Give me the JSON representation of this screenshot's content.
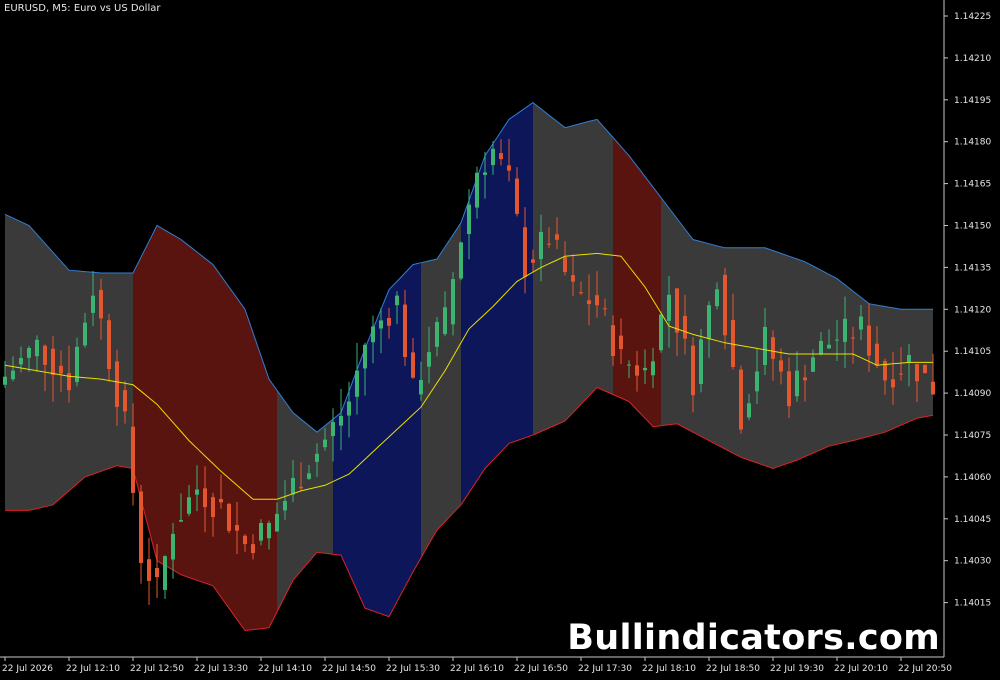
{
  "chart_title": "EURUSD, M5:  Euro vs US Dollar",
  "watermark": "Bullindicators.com",
  "colors": {
    "background": "#000000",
    "axis": "#c8c8c8",
    "bull_candle": "#3cb371",
    "bear_candle": "#e4572e",
    "strong_bear_candle": "#ff2a00",
    "strong_bull_candle": "#2fe06a",
    "band_upper": "#2f7fd6",
    "band_lower": "#e0202a",
    "middle_line": "#e8e000",
    "zone_neutral": "#3a3a3a",
    "zone_bear": "#5a1410",
    "zone_bull": "#0c1658"
  },
  "chart_data": {
    "type": "candlestick",
    "symbol": "EURUSD",
    "timeframe": "M5",
    "title": "EURUSD, M5:  Euro vs US Dollar",
    "y_ticks": [
      "1.14225",
      "1.14210",
      "1.14195",
      "1.14180",
      "1.14165",
      "1.14150",
      "1.14135",
      "1.14120",
      "1.14105",
      "1.14090",
      "1.14075",
      "1.14060",
      "1.14045",
      "1.14030",
      "1.14015"
    ],
    "y_tick_values": [
      1.14225,
      1.1421,
      1.14195,
      1.1418,
      1.14165,
      1.1415,
      1.14135,
      1.1412,
      1.14105,
      1.1409,
      1.14075,
      1.1406,
      1.14045,
      1.1403,
      1.14015
    ],
    "x_ticks": [
      "22 Jul 2026",
      "22 Jul 12:10",
      "22 Jul 12:50",
      "22 Jul 13:30",
      "22 Jul 14:10",
      "22 Jul 14:50",
      "22 Jul 15:30",
      "22 Jul 16:10",
      "22 Jul 16:50",
      "22 Jul 17:30",
      "22 Jul 18:10",
      "22 Jul 18:50",
      "22 Jul 19:30",
      "22 Jul 20:10",
      "22 Jul 20:50"
    ],
    "x_tick_bars": [
      0,
      8,
      16,
      24,
      32,
      40,
      48,
      56,
      64,
      72,
      80,
      88,
      96,
      104,
      112
    ],
    "bar_count": 117,
    "upper_band_keypoints": [
      [
        0,
        1.14154
      ],
      [
        3,
        1.1415
      ],
      [
        8,
        1.14134
      ],
      [
        12,
        1.14133
      ],
      [
        16,
        1.14133
      ],
      [
        19,
        1.1415
      ],
      [
        22,
        1.14145
      ],
      [
        26,
        1.14136
      ],
      [
        30,
        1.1412
      ],
      [
        33,
        1.14095
      ],
      [
        36,
        1.14083
      ],
      [
        39,
        1.14076
      ],
      [
        42,
        1.14083
      ],
      [
        45,
        1.14106
      ],
      [
        48,
        1.14127
      ],
      [
        51,
        1.14136
      ],
      [
        54,
        1.14138
      ],
      [
        57,
        1.14151
      ],
      [
        60,
        1.14175
      ],
      [
        63,
        1.14188
      ],
      [
        66,
        1.14194
      ],
      [
        70,
        1.14185
      ],
      [
        74,
        1.14188
      ],
      [
        78,
        1.14175
      ],
      [
        82,
        1.1416
      ],
      [
        86,
        1.14145
      ],
      [
        90,
        1.14142
      ],
      [
        95,
        1.14142
      ],
      [
        100,
        1.14137
      ],
      [
        104,
        1.14131
      ],
      [
        108,
        1.14122
      ],
      [
        112,
        1.1412
      ],
      [
        116,
        1.1412
      ]
    ],
    "lower_band_keypoints": [
      [
        0,
        1.14048
      ],
      [
        3,
        1.14048
      ],
      [
        6,
        1.1405
      ],
      [
        10,
        1.1406
      ],
      [
        14,
        1.14064
      ],
      [
        16,
        1.14063
      ],
      [
        19,
        1.1403
      ],
      [
        22,
        1.14025
      ],
      [
        26,
        1.14021
      ],
      [
        30,
        1.14005
      ],
      [
        33,
        1.14006
      ],
      [
        36,
        1.14023
      ],
      [
        39,
        1.14033
      ],
      [
        42,
        1.14032
      ],
      [
        45,
        1.14013
      ],
      [
        48,
        1.1401
      ],
      [
        51,
        1.14026
      ],
      [
        54,
        1.14041
      ],
      [
        57,
        1.1405
      ],
      [
        60,
        1.14063
      ],
      [
        63,
        1.14072
      ],
      [
        66,
        1.14075
      ],
      [
        70,
        1.1408
      ],
      [
        74,
        1.14092
      ],
      [
        78,
        1.14087
      ],
      [
        81,
        1.14078
      ],
      [
        84,
        1.14079
      ],
      [
        88,
        1.14073
      ],
      [
        92,
        1.14067
      ],
      [
        96,
        1.14063
      ],
      [
        99,
        1.14066
      ],
      [
        103,
        1.14071
      ],
      [
        106,
        1.14073
      ],
      [
        110,
        1.14076
      ],
      [
        114,
        1.14081
      ],
      [
        116,
        1.14082
      ]
    ],
    "middle_line_keypoints": [
      [
        0,
        1.141
      ],
      [
        4,
        1.14098
      ],
      [
        8,
        1.14096
      ],
      [
        12,
        1.14095
      ],
      [
        16,
        1.14093
      ],
      [
        19,
        1.14086
      ],
      [
        23,
        1.14073
      ],
      [
        27,
        1.14062
      ],
      [
        31,
        1.14052
      ],
      [
        34,
        1.14052
      ],
      [
        37,
        1.14055
      ],
      [
        40,
        1.14057
      ],
      [
        43,
        1.14061
      ],
      [
        46,
        1.14069
      ],
      [
        49,
        1.14077
      ],
      [
        52,
        1.14085
      ],
      [
        55,
        1.14098
      ],
      [
        58,
        1.14113
      ],
      [
        61,
        1.14121
      ],
      [
        64,
        1.1413
      ],
      [
        67,
        1.14135
      ],
      [
        70,
        1.14139
      ],
      [
        74,
        1.1414
      ],
      [
        77,
        1.14139
      ],
      [
        80,
        1.14128
      ],
      [
        83,
        1.14114
      ],
      [
        86,
        1.14111
      ],
      [
        90,
        1.14108
      ],
      [
        94,
        1.14106
      ],
      [
        98,
        1.14104
      ],
      [
        102,
        1.14104
      ],
      [
        106,
        1.14104
      ],
      [
        109,
        1.141
      ],
      [
        113,
        1.14101
      ],
      [
        116,
        1.14101
      ]
    ],
    "zones": [
      {
        "type": "neutral",
        "start": 0,
        "end": 15
      },
      {
        "type": "bear",
        "start": 16,
        "end": 33
      },
      {
        "type": "neutral",
        "start": 34,
        "end": 40
      },
      {
        "type": "bull",
        "start": 41,
        "end": 51
      },
      {
        "type": "neutral",
        "start": 52,
        "end": 56
      },
      {
        "type": "bull",
        "start": 57,
        "end": 65
      },
      {
        "type": "neutral",
        "start": 66,
        "end": 75
      },
      {
        "type": "bear",
        "start": 76,
        "end": 81
      },
      {
        "type": "neutral",
        "start": 82,
        "end": 116
      }
    ],
    "ohlc_anchor_closes": [
      [
        0,
        1.14096
      ],
      [
        4,
        1.14107
      ],
      [
        8,
        1.14095
      ],
      [
        11,
        1.14128
      ],
      [
        15,
        1.14078
      ],
      [
        17,
        1.14032
      ],
      [
        19,
        1.14019
      ],
      [
        21,
        1.14043
      ],
      [
        24,
        1.14056
      ],
      [
        27,
        1.14049
      ],
      [
        30,
        1.14036
      ],
      [
        33,
        1.14042
      ],
      [
        36,
        1.14057
      ],
      [
        40,
        1.14073
      ],
      [
        43,
        1.14087
      ],
      [
        45,
        1.14108
      ],
      [
        47,
        1.14116
      ],
      [
        49,
        1.14123
      ],
      [
        51,
        1.1409
      ],
      [
        53,
        1.14107
      ],
      [
        55,
        1.14116
      ],
      [
        57,
        1.14146
      ],
      [
        59,
        1.1417
      ],
      [
        61,
        1.14177
      ],
      [
        63,
        1.14165
      ],
      [
        65,
        1.14136
      ],
      [
        68,
        1.14146
      ],
      [
        71,
        1.14126
      ],
      [
        74,
        1.14122
      ],
      [
        77,
        1.14102
      ],
      [
        80,
        1.14098
      ],
      [
        83,
        1.14126
      ],
      [
        86,
        1.14095
      ],
      [
        89,
        1.14133
      ],
      [
        92,
        1.14082
      ],
      [
        95,
        1.14109
      ],
      [
        98,
        1.1409
      ],
      [
        101,
        1.14104
      ],
      [
        104,
        1.1411
      ],
      [
        107,
        1.14113
      ],
      [
        110,
        1.14096
      ],
      [
        113,
        1.14102
      ],
      [
        116,
        1.14092
      ]
    ],
    "grid": false
  }
}
